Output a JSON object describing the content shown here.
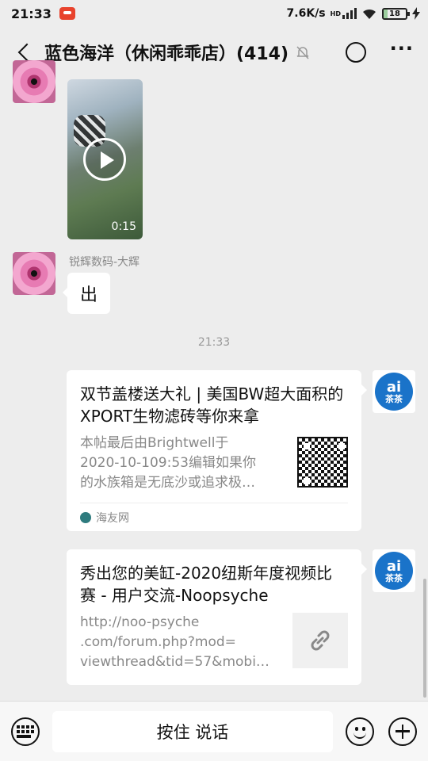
{
  "status_bar": {
    "time": "21:33",
    "net_speed": "7.6K/s",
    "hd_label": "HD",
    "battery": "18"
  },
  "header": {
    "title": "蓝色海洋（休闲乖乖店）(414)",
    "icons": [
      "back-icon",
      "mute-bell-icon",
      "refresh-icon",
      "more-icon"
    ]
  },
  "messages": {
    "video": {
      "duration": "0:15"
    },
    "text_msg": {
      "sender": "锐辉数码-大辉",
      "text": "出"
    },
    "timestamp": "21:33",
    "card1": {
      "title": "双节盖楼送大礼 | 美国BW超大面积的XPORT生物滤砖等你来拿",
      "desc_lines": [
        "本帖最后由Brightwell于",
        "2020-10-109:53编辑如果你",
        "的水族箱是无底沙或追求极…"
      ],
      "source": "海友网"
    },
    "card2": {
      "title": "秀出您的美缸-2020纽斯年度视频比赛 - 用户交流-Noopsyche",
      "desc_lines": [
        "http://noo-psyche",
        ".com/forum.php?mod=",
        "viewthread&tid=57&mobi…"
      ]
    }
  },
  "avatar_ai": {
    "top": "ai",
    "bottom": "茶茶"
  },
  "input_bar": {
    "hold_to_talk": "按住 说话"
  },
  "colors": {
    "background": "#ededed",
    "bubble": "#ffffff",
    "accent_blue": "#1a73c9"
  }
}
